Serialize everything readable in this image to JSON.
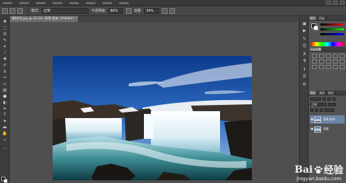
{
  "options_bar": {
    "mode_label": "模式:",
    "mode_value": "正常",
    "opacity_label": "不透明度:",
    "opacity_value": "88%",
    "flow_label": "流量:",
    "flow_value": "34%"
  },
  "document": {
    "tab_title": "素材26.jpg @ 43.2% (背景 副本, RGB/8#) *"
  },
  "panels": {
    "color_tabs": [
      "颜色",
      "色板"
    ],
    "adjust_label": "添加调整",
    "layer_tabs": [
      "图层",
      "通道",
      "路径"
    ],
    "blend_mode": "正常",
    "layers": [
      {
        "name": "背景 副本",
        "selected": true
      },
      {
        "name": "背景",
        "selected": false
      }
    ]
  },
  "watermark": {
    "brand_left": "Bai",
    "brand_right": "经验",
    "url": "jingyan.baidu.com"
  },
  "colors": {
    "app_bg": "#535353",
    "menubar": "#3a3a3a",
    "selected_layer": "#6a86a6"
  }
}
